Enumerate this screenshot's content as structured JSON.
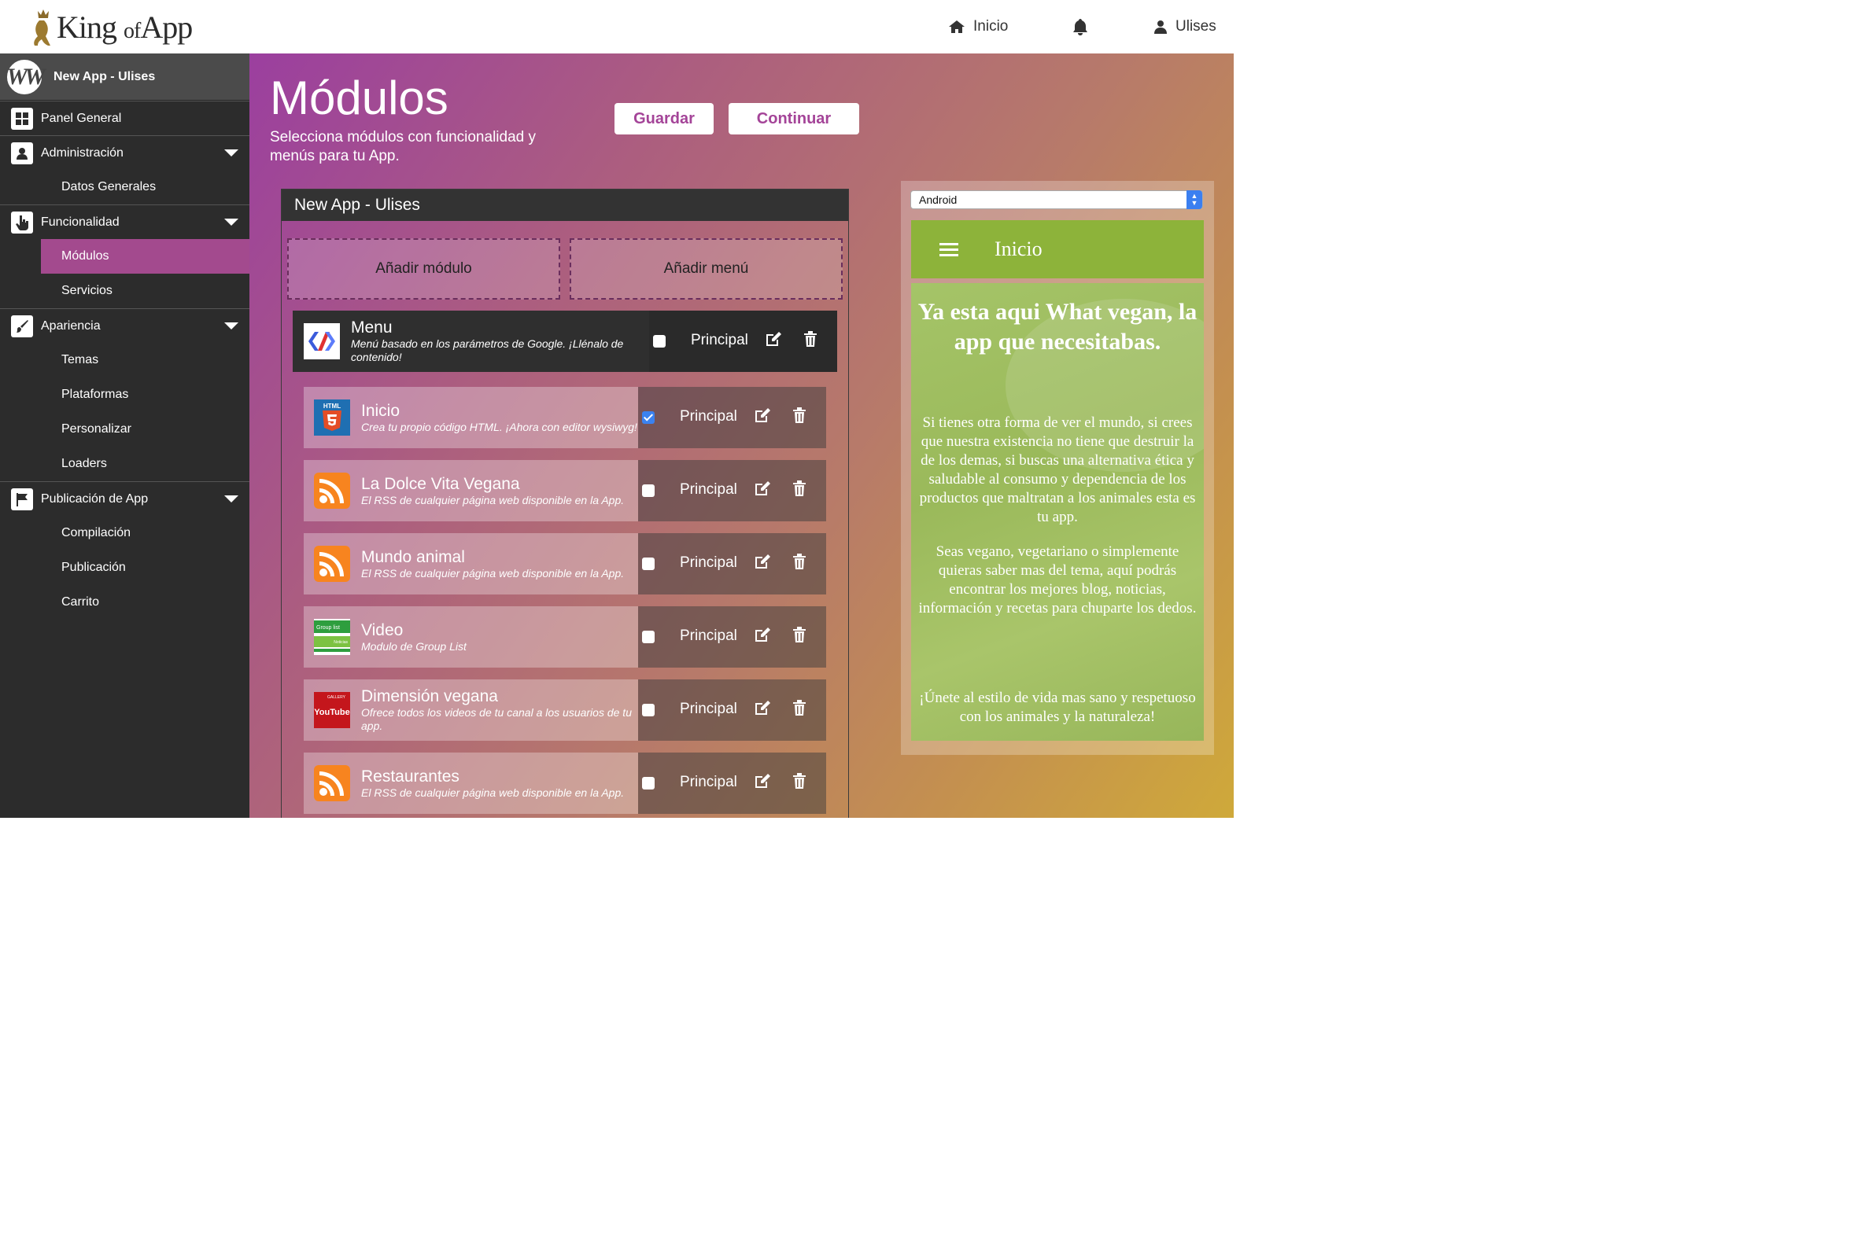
{
  "header": {
    "logo_text": "King",
    "logo_of": "of",
    "logo_app": "App",
    "nav": {
      "home_label": "Inicio",
      "user_label": "Ulises"
    }
  },
  "sidebar": {
    "app_name": "New App - Ulises",
    "app_logo_letter": "W",
    "panel_general": "Panel General",
    "administracion": {
      "label": "Administración",
      "items": [
        "Datos Generales"
      ]
    },
    "funcionalidad": {
      "label": "Funcionalidad",
      "items": [
        "Módulos",
        "Servicios"
      ]
    },
    "apariencia": {
      "label": "Apariencia",
      "items": [
        "Temas",
        "Plataformas",
        "Personalizar",
        "Loaders"
      ]
    },
    "publicacion": {
      "label": "Publicación de App",
      "items": [
        "Compilación",
        "Publicación",
        "Carrito"
      ]
    }
  },
  "main": {
    "title": "Módulos",
    "subtitle": "Selecciona módulos con funcionalidad y menús para tu App.",
    "save_label": "Guardar",
    "continue_label": "Continuar",
    "panel_title": "New App - Ulises",
    "add_module": "Añadir módulo",
    "add_menu": "Añadir menú",
    "menu": {
      "title": "Menu",
      "desc": "Menú basado en los parámetros de Google. ¡Llénalo de contenido!",
      "principal": "Principal",
      "checked": false
    },
    "modules": [
      {
        "title": "Inicio",
        "desc": "Crea tu propio código HTML. ¡Ahora con editor wysiwyg!",
        "icon": "html5-icon",
        "principal": "Principal",
        "checked": true
      },
      {
        "title": "La Dolce Vita Vegana",
        "desc": "El RSS de cualquier página web disponible en la App.",
        "icon": "rss-icon",
        "principal": "Principal",
        "checked": false
      },
      {
        "title": "Mundo animal",
        "desc": "El RSS de cualquier página web disponible en la App.",
        "icon": "rss-icon",
        "principal": "Principal",
        "checked": false
      },
      {
        "title": "Video",
        "desc": "Modulo de Group List",
        "icon": "group-list-icon",
        "principal": "Principal",
        "checked": false
      },
      {
        "title": "Dimensión vegana",
        "desc": "Ofrece todos los videos de tu canal a los usuarios de tu app.",
        "icon": "youtube-icon",
        "principal": "Principal",
        "checked": false
      },
      {
        "title": "Restaurantes",
        "desc": "El RSS de cualquier página web disponible en la App.",
        "icon": "rss-icon",
        "principal": "Principal",
        "checked": false
      }
    ],
    "group_icon_text": {
      "top": "Group list",
      "bottom": "Noticias"
    },
    "youtube_icon_text": {
      "top": "GALLERY",
      "main": "YouTube"
    },
    "html5_icon_text": "HTML"
  },
  "preview": {
    "platform": "Android",
    "screen_title": "Inicio",
    "heading": "Ya esta aqui What vegan, la app que necesitabas.",
    "paragraph1": "Si tienes otra forma de ver el mundo, si crees que nuestra existencia no tiene que destruir la de los demas, si buscas una alternativa ética y saludable al consumo y dependencia de los productos que maltratan a los animales esta es tu app.",
    "paragraph2": "Seas vegano, vegetariano o simplemente quieras saber mas del tema, aquí podrás encontrar los mejores blog, noticias, información y recetas para chuparte los dedos.",
    "paragraph3": "¡Únete al estilo de vida mas sano y respetuoso con los animales y la naturaleza!"
  },
  "colors": {
    "accent": "#a44498",
    "sidebar_bg": "#2c2c2c",
    "sidebar_active": "#a34a8e",
    "phone_bar": "#8db33a"
  }
}
